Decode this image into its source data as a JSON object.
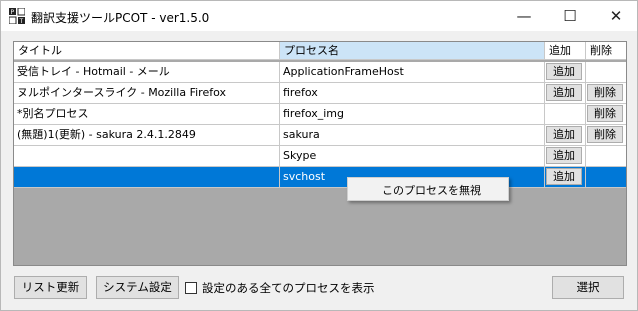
{
  "window": {
    "title": "翻訳支援ツールPCOT - ver1.5.0",
    "minimize_glyph": "—",
    "maximize_glyph": "☐",
    "close_glyph": "✕",
    "app_icon": "pcot-app-icon"
  },
  "grid": {
    "columns": [
      "タイトル",
      "プロセス名",
      "追加",
      "削除"
    ],
    "selected_column": "プロセス名",
    "rows": [
      {
        "title": "受信トレイ - Hotmail - メール",
        "process": "ApplicationFrameHost",
        "add": "追加",
        "del": ""
      },
      {
        "title": "ヌルポインタースライク - Mozilla Firefox",
        "process": "firefox",
        "add": "追加",
        "del": "削除"
      },
      {
        "title": "*別名プロセス",
        "process": "firefox_img",
        "add": "",
        "del": "削除"
      },
      {
        "title": "(無題)1(更新) - sakura 2.4.1.2849",
        "process": "sakura",
        "add": "追加",
        "del": "削除"
      },
      {
        "title": "",
        "process": "Skype",
        "add": "追加",
        "del": ""
      },
      {
        "title": "",
        "process": "svchost",
        "add": "追加",
        "del": "",
        "selected": true
      }
    ]
  },
  "context_menu": {
    "item": "このプロセスを無視"
  },
  "footer": {
    "refresh_label": "リスト更新",
    "settings_label": "システム設定",
    "checkbox_label": "設定のある全てのプロセスを表示",
    "checkbox_checked": false,
    "select_label": "選択"
  },
  "colors": {
    "selection": "#0078d7",
    "header_selected": "#cce4f7",
    "empty_area": "#a9a9a9"
  }
}
